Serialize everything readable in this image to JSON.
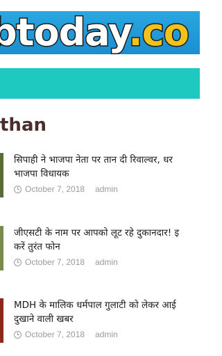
{
  "site": {
    "logo_text_main": "btoday",
    "logo_text_tld": ".co"
  },
  "section": {
    "title": "than"
  },
  "posts": [
    {
      "title_line1": "सिपाही ने भाजपा नेता पर तान दी रिवाल्वर, धर",
      "title_line2": "भाजपा विधायक",
      "date": "October 7, 2018",
      "author": "admin",
      "thumb_color": "#5a6b3a"
    },
    {
      "title_line1": "जीएसटी के नाम पर आपको लूट रहे दुकानदार! इ",
      "title_line2": "करें तुरंत फोन",
      "date": "October 7, 2018",
      "author": "admin",
      "thumb_color": "#7a8a4a"
    },
    {
      "title_line1": "MDH के मालिक धर्मपाल गुलाटी को लेकर आई",
      "title_line2": "दुखाने वाली खबर",
      "date": "October 7, 2018",
      "author": "admin",
      "thumb_color": "#8a2a1e"
    }
  ],
  "colors": {
    "nav": "#1ec9bf",
    "banner": "#1b8ed0",
    "heading": "#4a2e2e",
    "meta": "#9a9a9a"
  }
}
